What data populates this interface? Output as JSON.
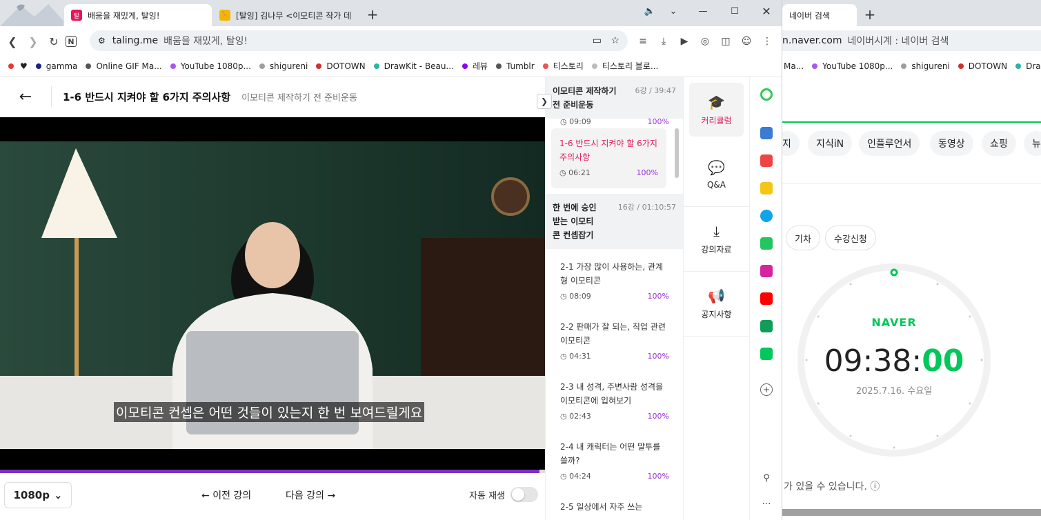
{
  "browser_left": {
    "tabs": [
      {
        "title": "배움을 재밌게, 탈잉!",
        "favicon": "taling"
      },
      {
        "title": "[탈잉] 김나무 <이모티콘 작가 데"
      }
    ],
    "url_host": "taling.me",
    "url_title": "배움을 재밌게, 탈잉!",
    "bookmarks": [
      "gamma",
      "Online GIF Ma...",
      "YouTube 1080p...",
      "shigureni",
      "DOTOWN",
      "DrawKit - Beau...",
      "레뷰",
      "Tumblr",
      "티스토리",
      "티스토리 블로..."
    ],
    "bookmark_colors": [
      "#e53935",
      "#111111",
      "#1a237e",
      "#555555",
      "#a855f7",
      "#9e9e9e",
      "#d32f2f",
      "#2bb5a3",
      "#8b00ff",
      "#555555",
      "#ef5350",
      "#bdbdbd"
    ]
  },
  "lecture": {
    "title": "1-6 반드시 지켜야 할 6가지 주의사항",
    "subtitle": "이모티콘 제작하기 전 준비운동",
    "caption": "이모티콘 컨셉은 어떤 것들이 있는지 한 번 보여드릴게요",
    "quality": "1080p",
    "prev": "이전 강의",
    "next": "다음 강의",
    "autoplay": "자동 재생",
    "progress": 0.99
  },
  "curriculum": {
    "section1": {
      "title": "이모티콘 제작하기 전 준비운동",
      "meta": "6강 / 39:47"
    },
    "partial": {
      "time": "09:09",
      "pct": "100%"
    },
    "active": {
      "title": "1-6 반드시 지켜야 할 6가지 주의사항",
      "time": "06:21",
      "pct": "100%"
    },
    "section2": {
      "title": "한 번에 승인받는 이모티콘 컨셉잡기",
      "meta": "16강 / 01:10:57"
    },
    "lessons": [
      {
        "title": "2-1 가장 많이 사용하는, 관계형 이모티콘",
        "time": "08:09",
        "pct": "100%"
      },
      {
        "title": "2-2 판매가 잘 되는, 직업 관련 이모티콘",
        "time": "04:31",
        "pct": "100%"
      },
      {
        "title": "2-3 내 성격, 주변사람 성격을 이모티콘에 입혀보기",
        "time": "02:43",
        "pct": "100%"
      },
      {
        "title": "2-4 내 캐릭터는 어떤 말투를 쓸까?",
        "time": "04:24",
        "pct": "100%"
      },
      {
        "title": "2-5 일상에서 자주 쓰는",
        "time": "",
        "pct": ""
      }
    ]
  },
  "sidemenu": [
    {
      "label": "커리큘럼",
      "icon": "graduation-cap-icon"
    },
    {
      "label": "Q&A",
      "icon": "chat-bubble-icon"
    },
    {
      "label": "강의자료",
      "icon": "download-icon"
    },
    {
      "label": "공지사항",
      "icon": "megaphone-icon"
    }
  ],
  "browser_right": {
    "tab_title": "네이버 검색",
    "url": "n.naver.com",
    "url_title": "네이버시계 : 네이버 검색",
    "bookmarks": [
      "Ma...",
      "YouTube 1080p...",
      "shigureni",
      "DOTOWN",
      "DrawK"
    ],
    "chips": [
      "지",
      "지식iN",
      "인플루언서",
      "동영상",
      "쇼핑",
      "뉴"
    ],
    "chips2": [
      "기차",
      "수강신청"
    ],
    "clock_brand": "NAVER",
    "clock_hm": "09:38:",
    "clock_sec": "00",
    "clock_date": "2025.7.16. 수요일",
    "notice": "가 있을 수 있습니다. ⓘ"
  },
  "colors": {
    "accent": "#e4165a",
    "purple": "#9b30d9",
    "naver": "#03c75a"
  }
}
